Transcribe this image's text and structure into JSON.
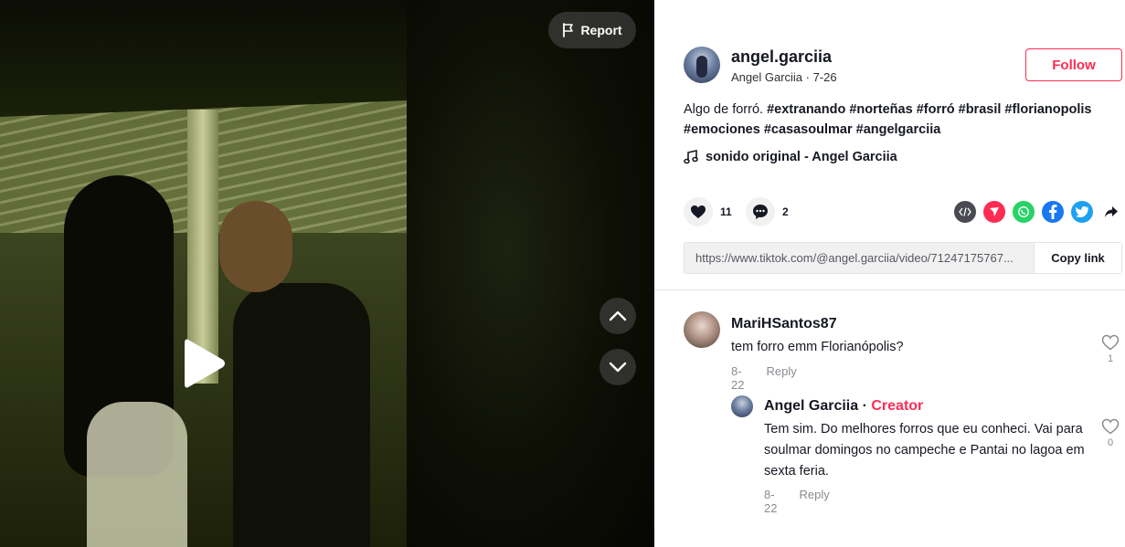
{
  "video": {
    "report_label": "Report"
  },
  "author": {
    "handle": "angel.garciia",
    "name_date": "Angel Garciia · 7-26",
    "follow_label": "Follow"
  },
  "caption": {
    "text": "Algo de forró.",
    "tags": [
      "#extranando",
      "#norteñas",
      "#forró",
      "#brasil",
      "#florianopolis",
      "#emociones",
      "#casasoulmar",
      "#angelgarciia"
    ]
  },
  "music": {
    "label": "sonido original - Angel Garciia"
  },
  "stats": {
    "likes": "11",
    "comments": "2"
  },
  "share": {
    "icons": [
      "embed-icon",
      "send-icon",
      "whatsapp-icon",
      "facebook-icon",
      "twitter-icon",
      "share-arrow-icon"
    ],
    "colors": {
      "embed": "#4a4b52",
      "send": "#fe2c55",
      "whatsapp": "#25d366",
      "facebook": "#1877f2",
      "twitter": "#1da1f2"
    }
  },
  "link": {
    "url": "https://www.tiktok.com/@angel.garciia/video/71247175767...",
    "copy_label": "Copy link"
  },
  "comments": [
    {
      "user": "MariHSantos87",
      "text": "tem forro emm Florianópolis?",
      "date": "8-22",
      "reply_label": "Reply",
      "likes": "1"
    },
    {
      "user": "Angel Garciia",
      "separator": " · ",
      "badge": "Creator",
      "text": "Tem sim. Do melhores forros que eu conheci. Vai para soulmar domingos no campeche e Pantai no lagoa em sexta feria.",
      "date": "8-22",
      "reply_label": "Reply",
      "likes": "0"
    }
  ],
  "colors": {
    "accent": "#fe2c55",
    "text": "#161823",
    "muted": "#8a8b91"
  }
}
